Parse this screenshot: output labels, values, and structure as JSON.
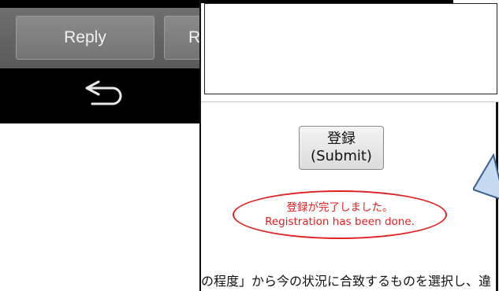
{
  "android": {
    "reply_label": "Reply",
    "second_button_label": "R",
    "back_icon": "back-arrow-icon"
  },
  "panel": {
    "submit": {
      "line1": "登録",
      "line2": "(Submit)"
    },
    "done_message": {
      "line1": "登録が完了しました。",
      "line2": "Registration has been done."
    },
    "instruction_text": "の程度」から今の状況に合致するものを選択し、違",
    "instruction_text_next": ""
  },
  "colors": {
    "accent_red": "#e32020",
    "callout_fill": "#c5d9f1",
    "callout_stroke": "#3a5f8f"
  }
}
